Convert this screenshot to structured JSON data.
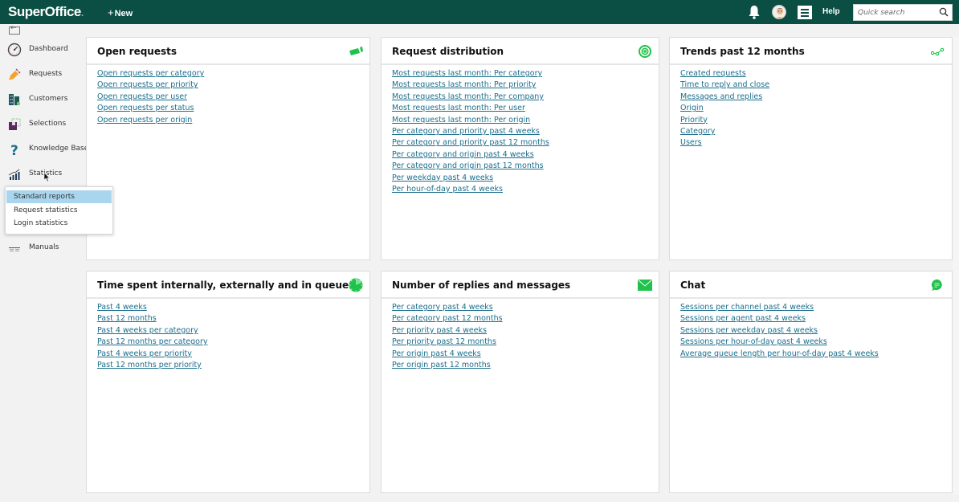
{
  "topbar": {
    "logo": "SuperOffice",
    "logo_dot": ".",
    "new_label": "New",
    "help_label": "Help",
    "search_placeholder": "Quick search",
    "icons": [
      "bell-icon",
      "avatar",
      "menu-icon",
      "search-icon"
    ],
    "bg_color": "#0b4e44"
  },
  "sidebar": {
    "items": [
      {
        "label": "Dashboard",
        "icon": "dashboard-icon"
      },
      {
        "label": "Requests",
        "icon": "requests-icon"
      },
      {
        "label": "Customers",
        "icon": "customers-icon"
      },
      {
        "label": "Selections",
        "icon": "selections-icon"
      },
      {
        "label": "Knowledge Base",
        "icon": "question-icon"
      },
      {
        "label": "Statistics",
        "icon": "statistics-icon"
      },
      {
        "label": "Manuals",
        "icon": "manuals-icon"
      }
    ],
    "flyout": {
      "items": [
        {
          "label": "Standard reports",
          "selected": true
        },
        {
          "label": "Request statistics",
          "selected": false
        },
        {
          "label": "Login statistics",
          "selected": false
        }
      ]
    }
  },
  "cards": [
    {
      "title": "Open requests",
      "icon": "ticket-icon",
      "links": [
        "Open requests per category",
        "Open requests per priority",
        "Open requests per user",
        "Open requests per status",
        "Open requests per origin"
      ]
    },
    {
      "title": "Request distribution",
      "icon": "target-icon",
      "links": [
        "Most requests last month: Per category",
        "Most requests last month: Per priority",
        "Most requests last month: Per company",
        "Most requests last month: Per user",
        "Most requests last month: Per origin",
        "Per category and priority past 4 weeks",
        "Per category and priority past 12 months",
        "Per category and origin past 4 weeks",
        "Per category and origin past 12 months",
        "Per weekday past 4 weeks",
        "Per hour-of-day past 4 weeks"
      ]
    },
    {
      "title": "Trends past 12 months",
      "icon": "trend-line-icon",
      "links": [
        "Created requests",
        "Time to reply and close",
        "Messages and replies",
        "Origin",
        "Priority",
        "Category",
        "Users"
      ]
    },
    {
      "title": "Time spent internally, externally and in queue",
      "icon": "clock-icon",
      "links": [
        "Past 4 weeks",
        "Past 12 months",
        "Past 4 weeks per category",
        "Past 12 months per category",
        "Past 4 weeks per priority",
        "Past 12 months per priority"
      ]
    },
    {
      "title": "Number of replies and messages",
      "icon": "envelope-icon",
      "links": [
        "Per category past 4 weeks",
        "Per category past 12 months",
        "Per priority past 4 weeks",
        "Per priority past 12 months",
        "Per origin past 4 weeks",
        "Per origin past 12 months"
      ]
    },
    {
      "title": "Chat",
      "icon": "chat-bubble-icon",
      "links": [
        "Sessions per channel past 4 weeks",
        "Sessions per agent past 4 weeks",
        "Sessions per weekday past 4 weeks",
        "Sessions per hour-of-day past 4 weeks",
        "Average queue length per hour-of-day past 4 weeks"
      ]
    }
  ],
  "colors": {
    "accent_green": "#1fc24a",
    "link": "#1b6e8c",
    "flyout_selected": "#a9d6ee"
  }
}
